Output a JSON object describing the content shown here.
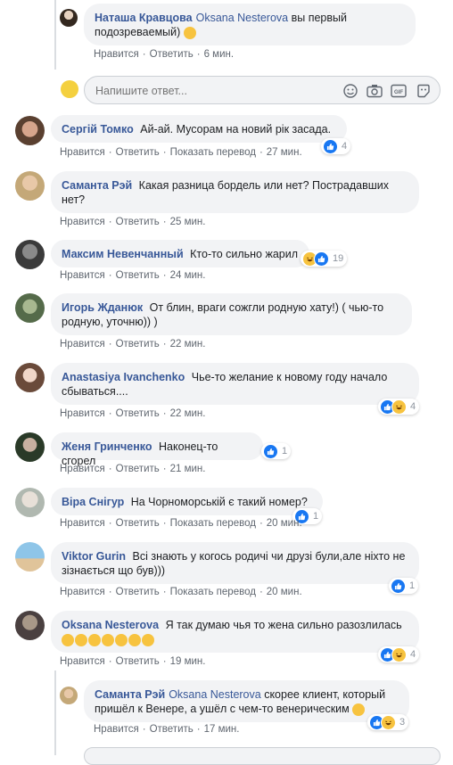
{
  "actions": {
    "like": "Нравится",
    "reply": "Ответить",
    "translate": "Показать перевод"
  },
  "reply_input": {
    "placeholder": "Напишите ответ..."
  },
  "comments": [
    {
      "author": "Наташа Кравцова",
      "mention": "Oksana Nesterova",
      "text": "вы первый подозреваемый)",
      "time": "6 мин.",
      "emoji": "smiling-face",
      "translate": false
    },
    {
      "author": "Сергій Томко",
      "text": "Ай-ай. Мусорам на новий рік засада.",
      "time": "27 мин.",
      "translate": true,
      "reactions": {
        "count": "4",
        "types": [
          "like"
        ]
      }
    },
    {
      "author": "Саманта Рэй",
      "text": "Какая разница бордель или нет? Пострадавших нет?",
      "time": "25 мин.",
      "translate": false
    },
    {
      "author": "Максим Невенчанный",
      "text": "Кто-то сильно жарил",
      "time": "24 мин.",
      "translate": false,
      "reactions": {
        "count": "19",
        "types": [
          "haha",
          "like"
        ]
      }
    },
    {
      "author": "Игорь Жданюк",
      "text": "От блин, враги сожгли родную хату!) ( чью-то родную, уточню)) )",
      "time": "22 мин.",
      "translate": false
    },
    {
      "author": "Anastasiya Ivanchenko",
      "text": "Чье-то желание к новому году начало сбываться....",
      "time": "22 мин.",
      "translate": false,
      "reactions": {
        "count": "4",
        "types": [
          "like",
          "haha"
        ]
      }
    },
    {
      "author": "Женя Гринченко",
      "text": "Наконец-то сгорел",
      "time": "21 мин.",
      "translate": false,
      "reactions": {
        "count": "1",
        "types": [
          "like"
        ]
      }
    },
    {
      "author": "Віра Снігур",
      "text": "На Чорноморській є такий номер?",
      "time": "20 мин.",
      "translate": true,
      "reactions": {
        "count": "1",
        "types": [
          "like"
        ]
      }
    },
    {
      "author": "Viktor Gurin",
      "text": "Всі знають у когось родичі чи друзі були,але ніхто не зізнається що був)))",
      "time": "20 мин.",
      "translate": true,
      "reactions": {
        "count": "1",
        "types": [
          "like"
        ]
      }
    },
    {
      "author": "Oksana Nesterova",
      "text": "Я так думаю чья то жена сильно разозлилась",
      "time": "19 мин.",
      "translate": false,
      "emoji": "laughing-faces",
      "reactions": {
        "count": "4",
        "types": [
          "like",
          "haha"
        ]
      }
    },
    {
      "author": "Саманта Рэй",
      "mention": "Oksana Nesterova",
      "text": "скорее клиент, который пришёл к Венере, а ушёл с чем-то венерическим",
      "time": "17 мин.",
      "emoji": "grinning-face",
      "translate": false,
      "reactions": {
        "count": "3",
        "types": [
          "like",
          "haha"
        ]
      }
    }
  ],
  "colors": {
    "link": "#385898",
    "like": "#1877f2",
    "haha": "#f7c33f",
    "bubble": "#f2f3f5",
    "meta": "#606770"
  }
}
